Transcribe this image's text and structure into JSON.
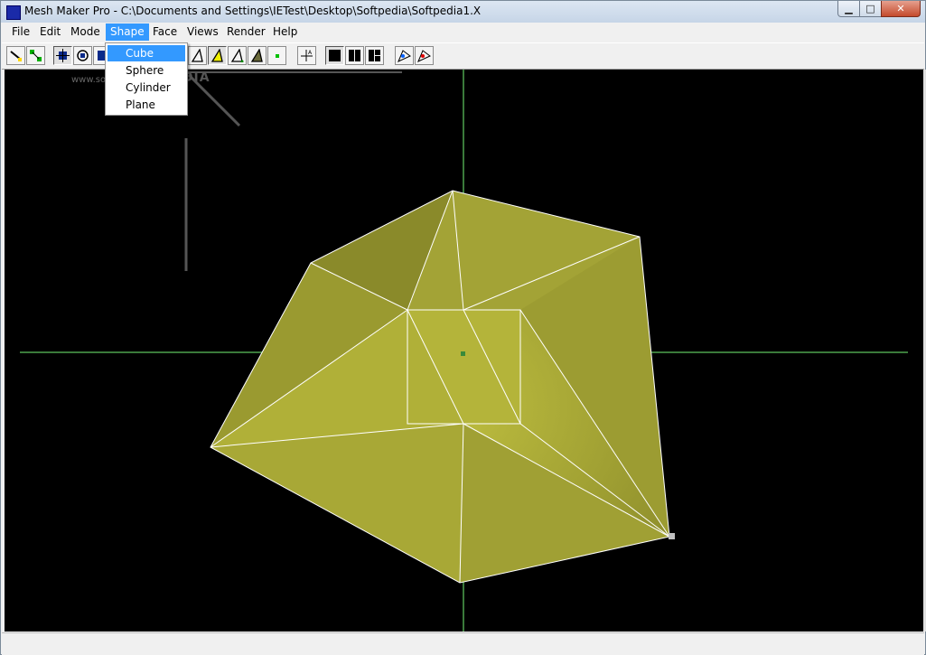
{
  "window": {
    "title": "Mesh Maker Pro -  C:\\Documents and Settings\\IETest\\Desktop\\Softpedia\\Softpedia1.X",
    "minimize_glyph": "▁",
    "maximize_glyph": "□",
    "close_glyph": "✕"
  },
  "menu": {
    "items": [
      "File",
      "Edit",
      "Mode",
      "Shape",
      "Face",
      "Views",
      "Render",
      "Help"
    ],
    "active": "Shape"
  },
  "shape_menu": {
    "items": [
      "Cube",
      "Sphere",
      "Cylinder",
      "Plane"
    ],
    "highlighted": "Cube"
  },
  "watermark": {
    "main": "SOFTPEDIA",
    "url": "www.softpedia.com"
  },
  "toolbar": {
    "tools": [
      "select-icon",
      "select-points-icon",
      "move-icon",
      "rotate-icon",
      "scale-icon",
      "triangle-outline-icon",
      "triangle-yellow-icon",
      "triangle-outline-icon",
      "triangle-shaded-icon",
      "point-icon",
      "axis-icon",
      "view-single-icon",
      "view-split-icon",
      "view-quad-icon",
      "brush-icon",
      "brush-red-icon"
    ]
  },
  "colors": {
    "mesh_fill": "#a8a838",
    "mesh_edge": "#ffffff",
    "axis": "#3a7a3a",
    "viewport_bg": "#000000",
    "menu_highlight": "#3399ff"
  }
}
